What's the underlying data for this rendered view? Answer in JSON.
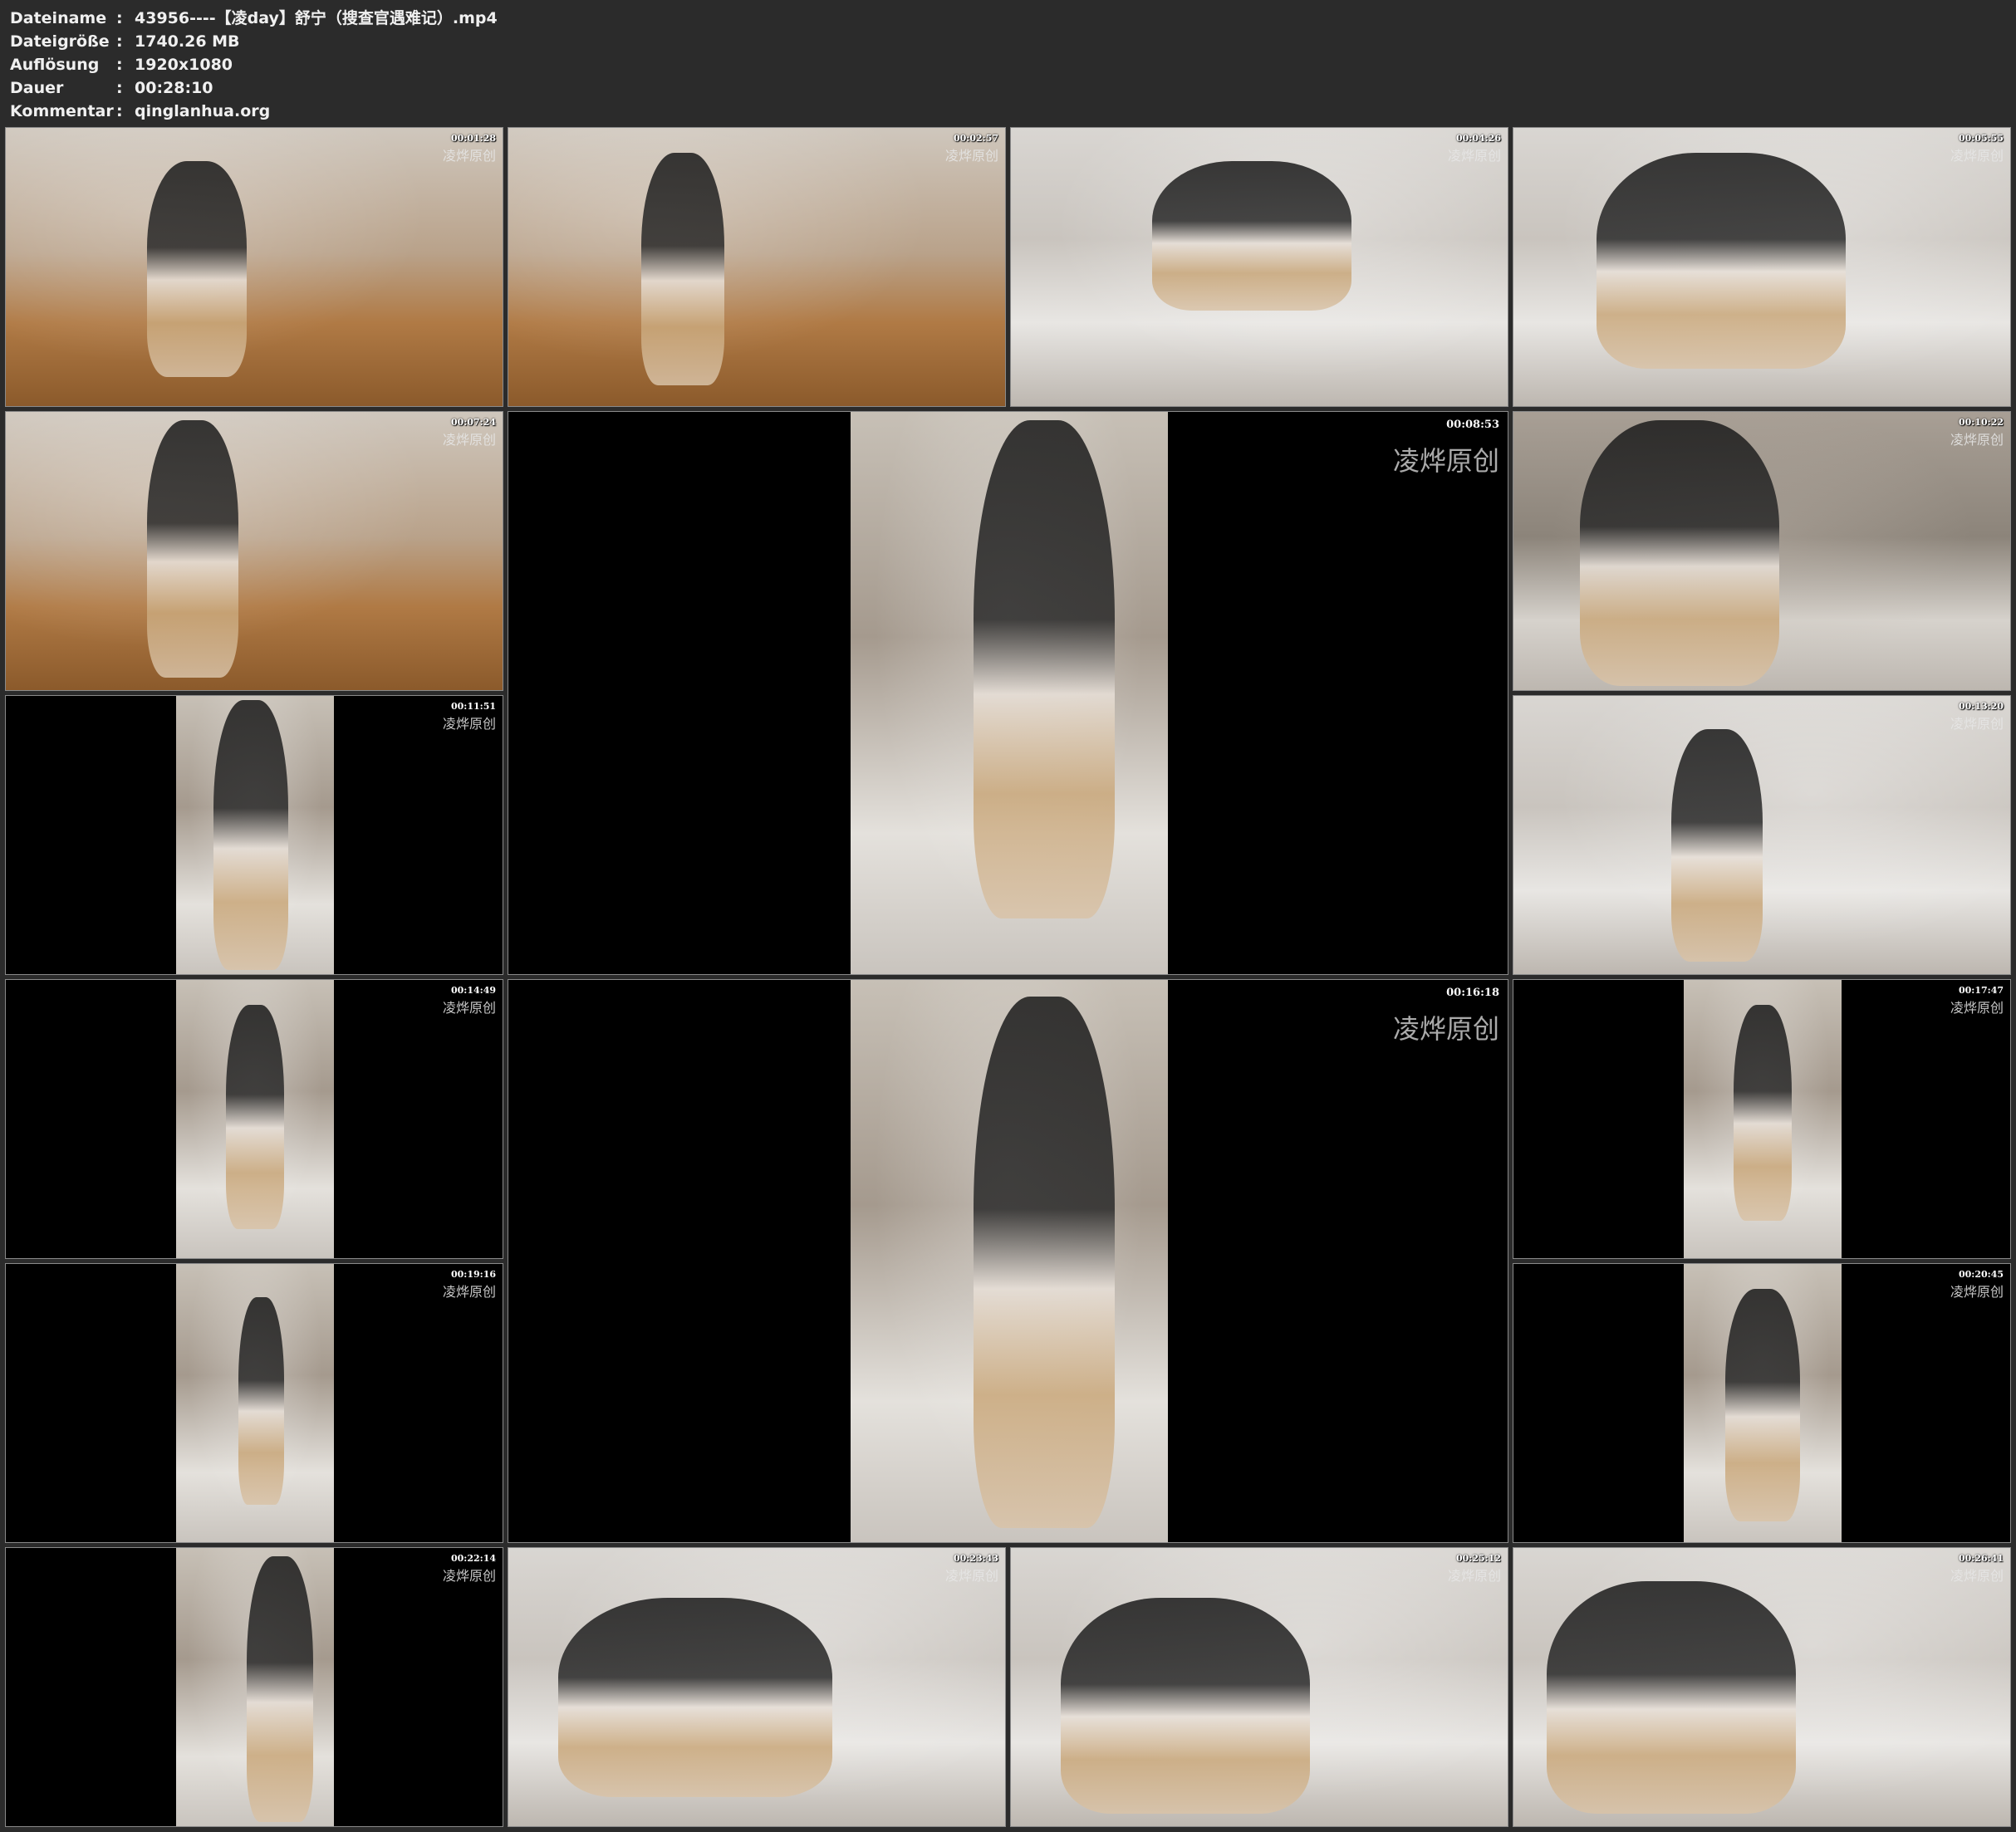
{
  "info": {
    "rows": [
      {
        "key": "Dateiname",
        "value": "43956----【凌day】舒宁（搜查官遇难记）.mp4"
      },
      {
        "key": "Dateigröße",
        "value": "1740.26 MB"
      },
      {
        "key": "Auflösung",
        "value": "1920x1080"
      },
      {
        "key": "Dauer",
        "value": "00:28:10"
      },
      {
        "key": "Kommentar",
        "value": "qinglanhua.org"
      }
    ],
    "separator": ":"
  },
  "watermark": "凌烨原创",
  "thumbnails": [
    {
      "timestamp": "00:01:28",
      "scene": "bedroom-wood"
    },
    {
      "timestamp": "00:02:57",
      "scene": "bedroom-wood"
    },
    {
      "timestamp": "00:04:26",
      "scene": "bed"
    },
    {
      "timestamp": "00:05:55",
      "scene": "bed"
    },
    {
      "timestamp": "00:07:24",
      "scene": "laundry"
    },
    {
      "timestamp": "00:08:53",
      "scene": "portrait-standing"
    },
    {
      "timestamp": "00:10:22",
      "scene": "room"
    },
    {
      "timestamp": "00:11:51",
      "scene": "portrait-standing"
    },
    {
      "timestamp": "00:13:20",
      "scene": "kneeling-bed"
    },
    {
      "timestamp": "00:14:49",
      "scene": "portrait-standing"
    },
    {
      "timestamp": "00:16:18",
      "scene": "portrait-standing"
    },
    {
      "timestamp": "00:17:47",
      "scene": "portrait-standing"
    },
    {
      "timestamp": "00:19:16",
      "scene": "portrait-standing"
    },
    {
      "timestamp": "00:20:45",
      "scene": "portrait-standing"
    },
    {
      "timestamp": "00:22:14",
      "scene": "portrait-standing"
    },
    {
      "timestamp": "00:23:43",
      "scene": "two-people-bed"
    },
    {
      "timestamp": "00:25:12",
      "scene": "two-people-bed"
    },
    {
      "timestamp": "00:26:41",
      "scene": "two-people-bed"
    }
  ]
}
